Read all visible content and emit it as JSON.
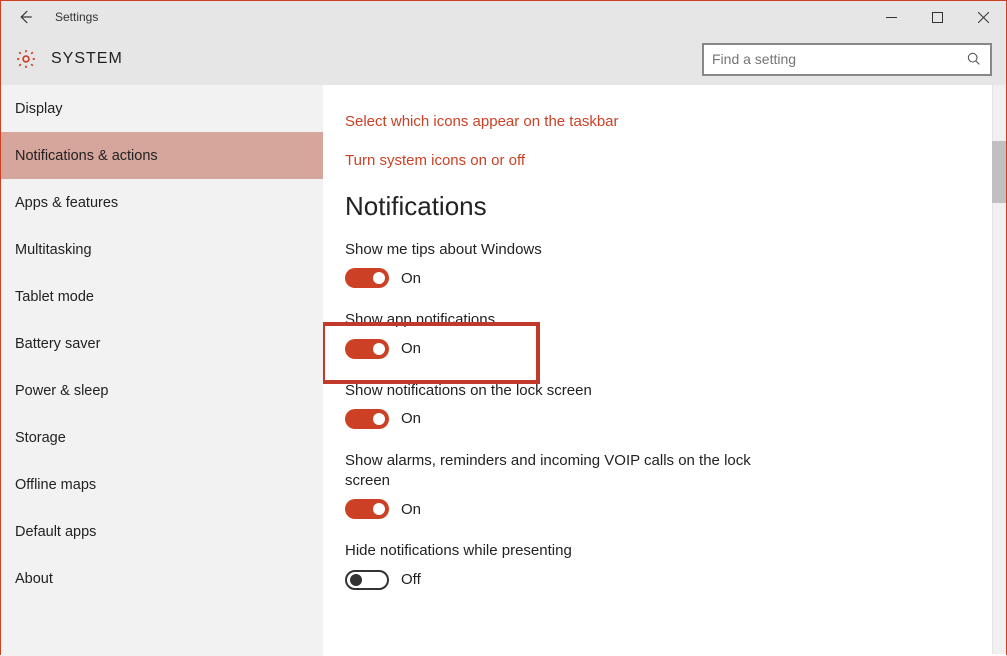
{
  "window": {
    "title": "Settings"
  },
  "header": {
    "title": "SYSTEM",
    "search_placeholder": "Find a setting"
  },
  "sidebar": {
    "items": [
      {
        "label": "Display",
        "active": false
      },
      {
        "label": "Notifications & actions",
        "active": true
      },
      {
        "label": "Apps & features",
        "active": false
      },
      {
        "label": "Multitasking",
        "active": false
      },
      {
        "label": "Tablet mode",
        "active": false
      },
      {
        "label": "Battery saver",
        "active": false
      },
      {
        "label": "Power & sleep",
        "active": false
      },
      {
        "label": "Storage",
        "active": false
      },
      {
        "label": "Offline maps",
        "active": false
      },
      {
        "label": "Default apps",
        "active": false
      },
      {
        "label": "About",
        "active": false
      }
    ]
  },
  "main": {
    "links": [
      "Select which icons appear on the taskbar",
      "Turn system icons on or off"
    ],
    "section_title": "Notifications",
    "states": {
      "on": "On",
      "off": "Off"
    },
    "settings": [
      {
        "label": "Show me tips about Windows",
        "on": true
      },
      {
        "label": "Show app notifications",
        "on": true,
        "highlighted": true
      },
      {
        "label": "Show notifications on the lock screen",
        "on": true
      },
      {
        "label": "Show alarms, reminders and incoming VOIP calls on the lock screen",
        "on": true
      },
      {
        "label": "Hide notifications while presenting",
        "on": false
      }
    ]
  },
  "colors": {
    "accent": "#cc4125",
    "sidebar_active": "#d6a59b",
    "highlight_border": "#c0392b"
  }
}
